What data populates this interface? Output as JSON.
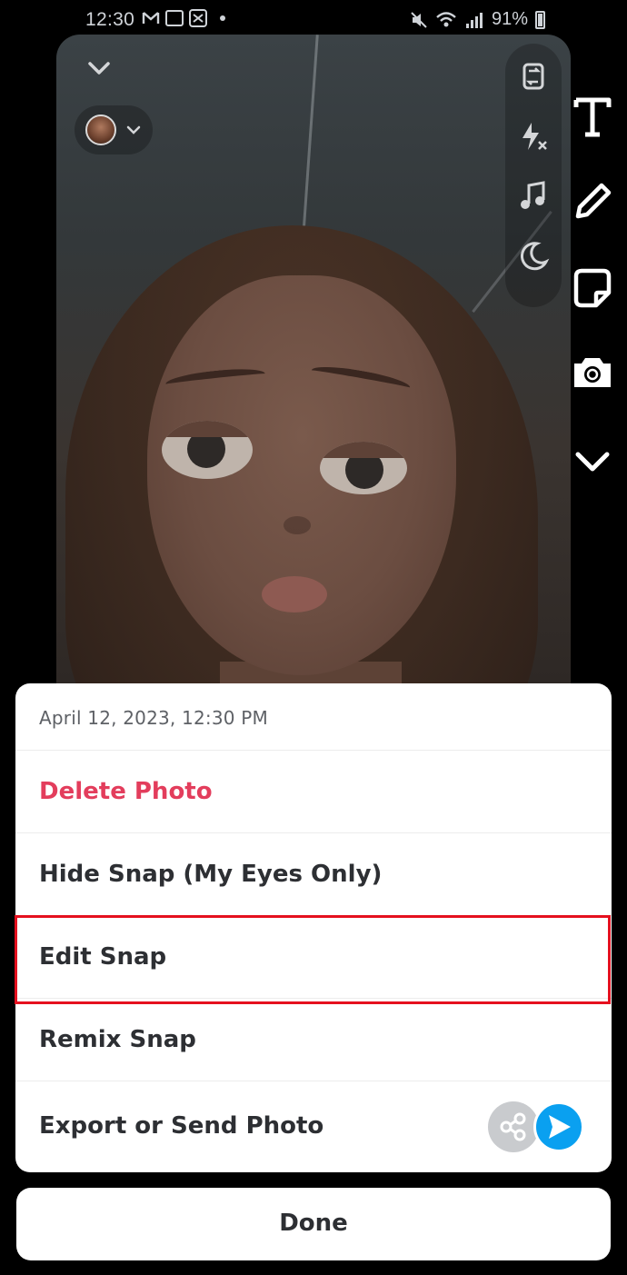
{
  "status_bar": {
    "time": "12:30",
    "battery": "91%"
  },
  "preview": {
    "tools": [
      "flip-camera-icon",
      "flash-off-icon",
      "music-note-icon",
      "night-mode-icon"
    ]
  },
  "right_toolbar": {
    "items": [
      "text-tool-icon",
      "pencil-icon",
      "sticker-icon",
      "lens-icon",
      "chevron-down-icon"
    ]
  },
  "sheet": {
    "date": "April 12, 2023, 12:30 PM",
    "delete": "Delete Photo",
    "hide": "Hide Snap (My Eyes Only)",
    "edit": "Edit Snap",
    "remix": "Remix Snap",
    "export": "Export or Send Photo"
  },
  "done_label": "Done",
  "colors": {
    "delete_red": "#e33d5c",
    "highlight_red": "#e5101f",
    "send_blue": "#0aa0f0"
  }
}
